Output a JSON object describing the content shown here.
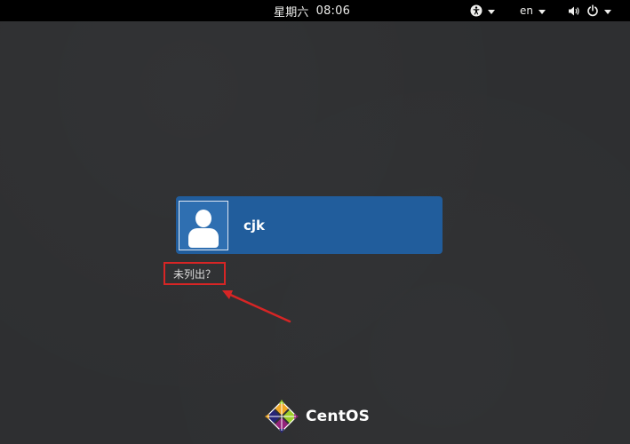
{
  "topbar": {
    "day": "星期六",
    "time": "08:06",
    "language": "en"
  },
  "user": {
    "name": "cjk"
  },
  "login": {
    "not_listed": "未列出？"
  },
  "branding": {
    "logo_text": "CentOS"
  },
  "colors": {
    "background": "#2e2f31",
    "topbar": "#000000",
    "user_card": "#215d9c",
    "annotation": "#d72525"
  },
  "icons": {
    "accessibility": "accessibility-icon",
    "volume": "volume-icon",
    "power": "power-icon",
    "dropdown": "chevron-down-icon",
    "avatar": "user-avatar-icon",
    "logo": "centos-logo-icon",
    "annotation_arrow": "red-arrow"
  }
}
